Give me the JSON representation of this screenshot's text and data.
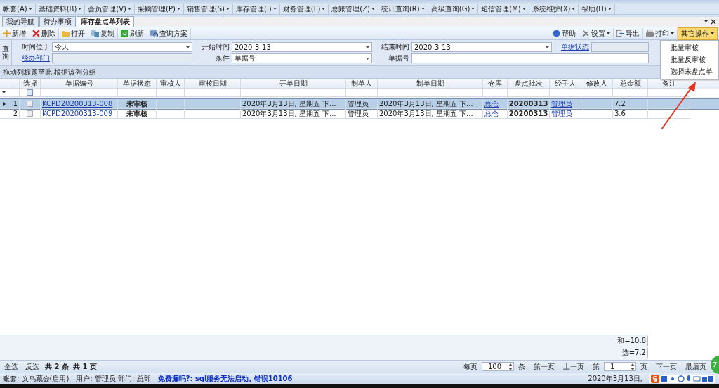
{
  "menu": [
    "帐套(A)",
    "基础资料(B)",
    "会员管理(V)",
    "采购管理(P)",
    "销售管理(S)",
    "库存管理(I)",
    "财务管理(F)",
    "总账管理(Z)",
    "统计查询(R)",
    "高级查询(G)",
    "短信管理(M)",
    "系统维护(X)",
    "帮助(H)"
  ],
  "tabs": [
    {
      "label": "我的导航",
      "selected": false
    },
    {
      "label": "待办事项",
      "selected": false
    },
    {
      "label": "库存盘点单列表",
      "selected": true
    }
  ],
  "toolbar_left": [
    "新增",
    "删除",
    "打开",
    "复制",
    "刷新",
    "查询方案"
  ],
  "toolbar_right": [
    {
      "label": "帮助",
      "dropdown": false,
      "selected": false
    },
    {
      "label": "设置",
      "dropdown": true,
      "selected": false
    },
    {
      "label": "导出",
      "dropdown": false,
      "selected": false
    },
    {
      "label": "打印",
      "dropdown": true,
      "selected": false
    },
    {
      "label": "其它操作",
      "dropdown": true,
      "selected": true
    }
  ],
  "dropdown_menu": [
    "批量审核",
    "批量反审核",
    "选择未盘点单"
  ],
  "query": {
    "side_label": "查询",
    "time_label": "时间位于",
    "time_value": "今天",
    "dept_label": "经办部门",
    "start_label": "开始时间",
    "start_value": "2020-3-13",
    "cond_label": "条件",
    "cond_value": "单据号",
    "end_label": "结束时间",
    "end_value": "2020-3-13",
    "no_label": "单据号",
    "status_label": "单据状态"
  },
  "group_hint": "拖动列标题至此,根据该列分组",
  "table": {
    "select_column": "选择",
    "filter_checked": false,
    "columns": [
      "单据编号",
      "单据状态",
      "审核人",
      "审核日期",
      "开单日期",
      "制单人",
      "制单日期",
      "仓库",
      "盘点批次",
      "经手人",
      "修改人",
      "总金额",
      "备注"
    ],
    "rows": [
      {
        "index": "1",
        "selected": true,
        "checked": false,
        "cells": [
          "KCPD20200313-008",
          "未审核",
          "",
          "",
          "2020年3月13日, 星期五 下...",
          "管理员",
          "2020年3月13日, 星期五 下...",
          "总仓",
          "20200313",
          "管理员",
          "",
          "7.2",
          ""
        ]
      },
      {
        "index": "2",
        "selected": false,
        "checked": false,
        "cells": [
          "KCPD20200313-009",
          "未审核",
          "",
          "",
          "2020年3月13日, 星期五 下...",
          "管理员",
          "2020年3月13日, 星期五 下...",
          "总仓",
          "20200313",
          "管理员",
          "",
          "3.6",
          ""
        ]
      }
    ],
    "sums": [
      "和=10.8",
      "选=7.2"
    ]
  },
  "footer": {
    "select_all": "全选",
    "invert": "反选",
    "count": "共 2 条",
    "pages": "共 1 页",
    "per_page_label": "每页",
    "per_page": "100",
    "per_unit": "条",
    "first": "第一页",
    "prev": "上一页",
    "page_label": "第",
    "page": "1",
    "page_unit": "页",
    "next": "下一页",
    "last": "最后页"
  },
  "status_bar": {
    "account": "账套: 义乌藏会(启用)",
    "user": "用户: 管理员  部门: 总部",
    "notice": "免费漏吗?: sql服务无法启动, 错误10106",
    "date": "2020年3月13日,"
  },
  "badge": "7"
}
